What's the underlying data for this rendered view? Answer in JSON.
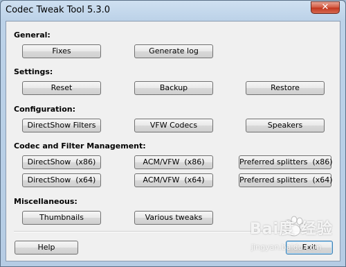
{
  "window": {
    "title": "Codec Tweak Tool 5.3.0",
    "close_glyph": "✕"
  },
  "sections": {
    "general": {
      "label": "General:",
      "buttons": [
        "Fixes",
        "Generate log"
      ]
    },
    "settings": {
      "label": "Settings:",
      "buttons": [
        "Reset",
        "Backup",
        "Restore"
      ]
    },
    "configuration": {
      "label": "Configuration:",
      "buttons": [
        "DirectShow Filters",
        "VFW Codecs",
        "Speakers"
      ]
    },
    "codec_management": {
      "label": "Codec and Filter Management:",
      "row1": [
        "DirectShow  (x86)",
        "ACM/VFW  (x86)",
        "Preferred splitters  (x86)"
      ],
      "row2": [
        "DirectShow  (x64)",
        "ACM/VFW  (x64)",
        "Preferred splitters  (x64)"
      ]
    },
    "miscellaneous": {
      "label": "Miscellaneous:",
      "buttons": [
        "Thumbnails",
        "Various tweaks"
      ]
    }
  },
  "footer": {
    "help_label": "Help",
    "exit_label": "Exit"
  },
  "watermark": {
    "brand": "Bai度 经验",
    "url": "jingyan.baidu.com"
  }
}
